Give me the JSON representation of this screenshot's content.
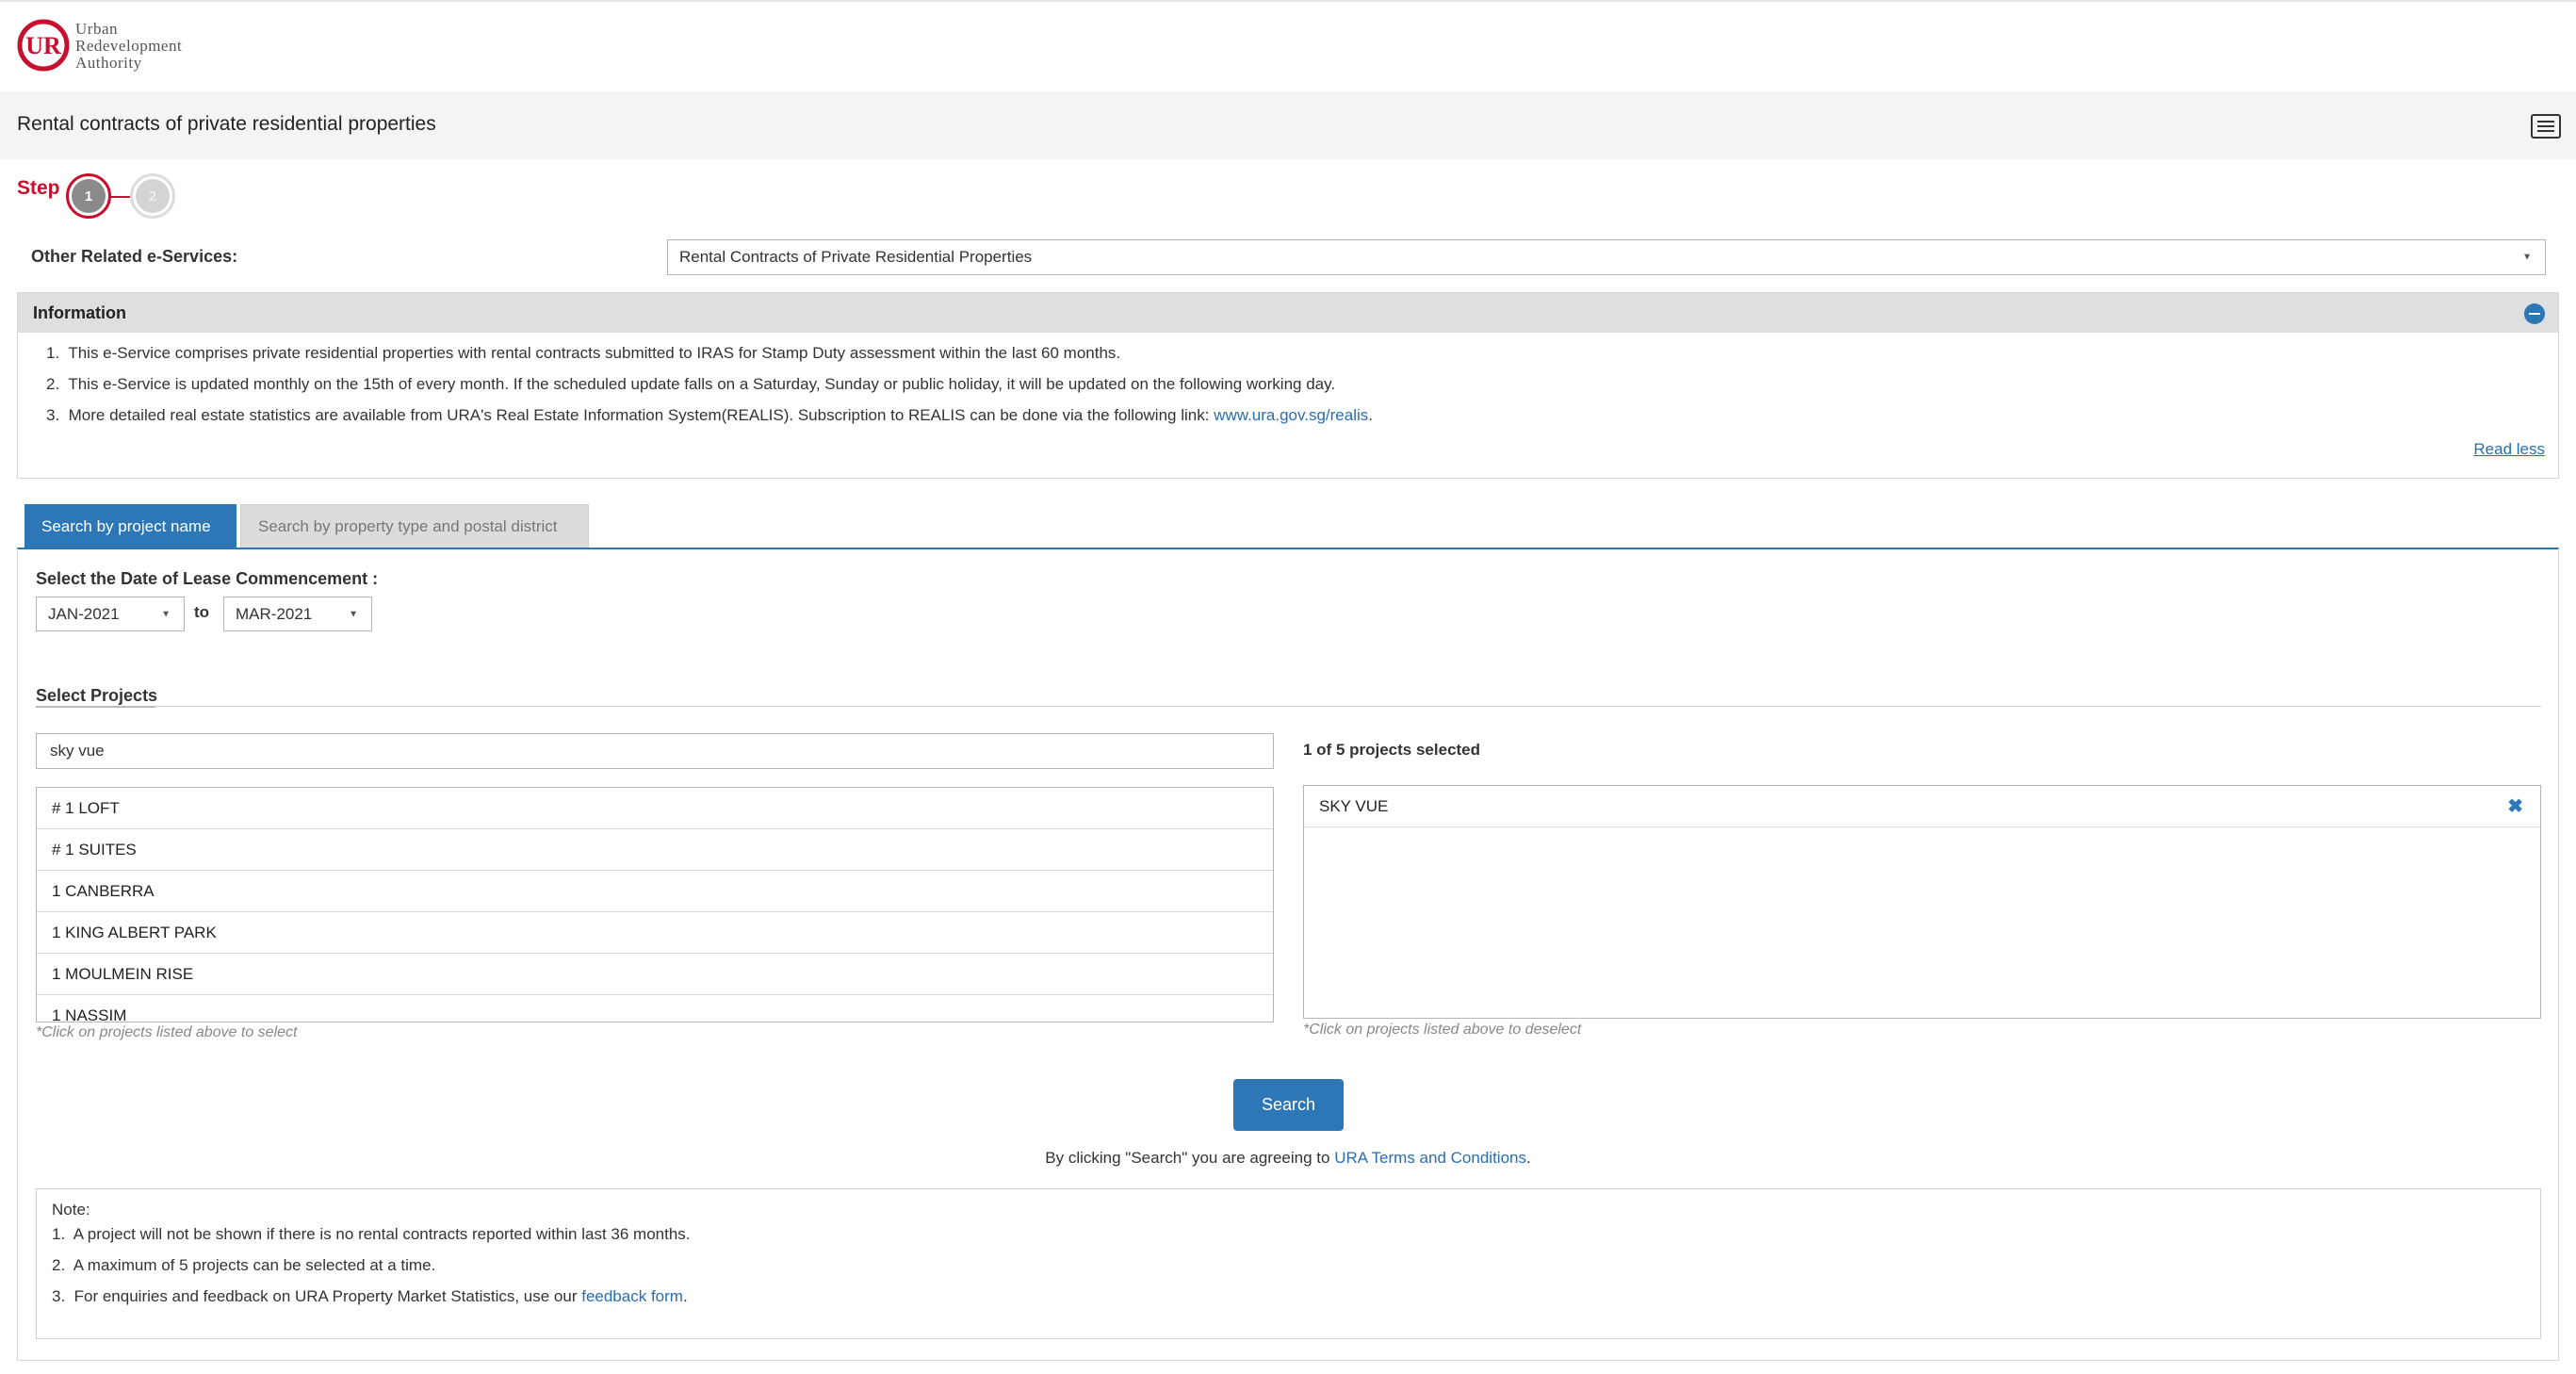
{
  "brand": {
    "line1": "Urban",
    "line2": "Redevelopment",
    "line3": "Authority",
    "color": "#c8102e"
  },
  "header": {
    "title": "Rental contracts of private residential properties"
  },
  "steps": {
    "label": "Step",
    "items": [
      "1",
      "2"
    ],
    "active": 1
  },
  "related": {
    "label": "Other Related e-Services:",
    "selected": "Rental Contracts of Private Residential Properties"
  },
  "info": {
    "title": "Information",
    "items": [
      "This e-Service comprises private residential properties with rental contracts submitted to IRAS for Stamp Duty assessment within the last 60 months.",
      "This e-Service is updated monthly on the 15th of every month. If the scheduled update falls on a Saturday, Sunday or public holiday, it will be updated on the following working day.",
      "More detailed real estate statistics are available from URA's Real Estate Information System(REALIS). Subscription to REALIS can be done via the following link: "
    ],
    "link_text": "www.ura.gov.sg/realis",
    "read_less": "Read less"
  },
  "tabs": [
    {
      "label": "Search by project name",
      "active": true
    },
    {
      "label": "Search by property type and postal district",
      "active": false
    }
  ],
  "lease": {
    "label": "Select the Date of Lease Commencement :",
    "from": "JAN-2021",
    "to_label": "to",
    "to": "MAR-2021"
  },
  "projects": {
    "label": "Select Projects",
    "search_value": "sky vue",
    "list": [
      "# 1 LOFT",
      "# 1 SUITES",
      "1 CANBERRA",
      "1 KING ALBERT PARK",
      "1 MOULMEIN RISE",
      "1 NASSIM"
    ],
    "hint_select": "*Click on projects listed above to select",
    "count_label": "1 of 5 projects selected",
    "selected": [
      "SKY VUE"
    ],
    "hint_deselect": "*Click on projects listed above to deselect"
  },
  "search": {
    "button": "Search",
    "agree_prefix": "By clicking \"Search\" you are agreeing to ",
    "agree_link": "URA Terms and Conditions",
    "agree_suffix": "."
  },
  "note": {
    "title": "Note:",
    "items": [
      "A project will not be shown if there is no rental contracts reported within last 36 months.",
      "A maximum of 5 projects can be selected at a time.",
      "For enquiries and feedback on URA Property Market Statistics, use our "
    ],
    "link_text": "feedback form",
    "link_suffix": "."
  },
  "colors": {
    "accent": "#2d77b7",
    "link": "#2a6db0",
    "step_active": "#c8102e"
  }
}
